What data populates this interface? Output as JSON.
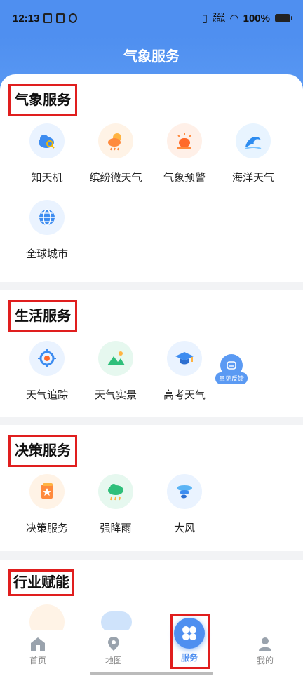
{
  "status": {
    "time": "12:13",
    "net_top": "22.2",
    "net_bottom": "KB/s",
    "battery": "100%"
  },
  "header": {
    "title": "气象服务"
  },
  "sections": [
    {
      "title": "气象服务",
      "items": [
        {
          "label": "知天机",
          "icon": "cloud-search-icon"
        },
        {
          "label": "缤纷微天气",
          "icon": "sun-cloud-rain-icon"
        },
        {
          "label": "气象预警",
          "icon": "alarm-siren-icon"
        },
        {
          "label": "海洋天气",
          "icon": "wave-icon"
        },
        {
          "label": "全球城市",
          "icon": "globe-icon"
        }
      ]
    },
    {
      "title": "生活服务",
      "items": [
        {
          "label": "天气追踪",
          "icon": "target-icon"
        },
        {
          "label": "天气实景",
          "icon": "landscape-icon"
        },
        {
          "label": "高考天气",
          "icon": "graduation-cap-icon"
        }
      ]
    },
    {
      "title": "决策服务",
      "items": [
        {
          "label": "决策服务",
          "icon": "scroll-star-icon"
        },
        {
          "label": "强降雨",
          "icon": "rain-cloud-icon"
        },
        {
          "label": "大风",
          "icon": "typhoon-icon"
        }
      ]
    },
    {
      "title": "行业赋能",
      "items": []
    }
  ],
  "feedback": {
    "label": "意见反馈"
  },
  "tabs": [
    {
      "label": "首页",
      "icon": "home-icon"
    },
    {
      "label": "地图",
      "icon": "map-pin-icon"
    },
    {
      "label": "服务",
      "icon": "clover-grid-icon"
    },
    {
      "label": "我的",
      "icon": "user-icon"
    }
  ],
  "colors": {
    "accent": "#4f8ff0",
    "highlight": "#e01e1e"
  }
}
